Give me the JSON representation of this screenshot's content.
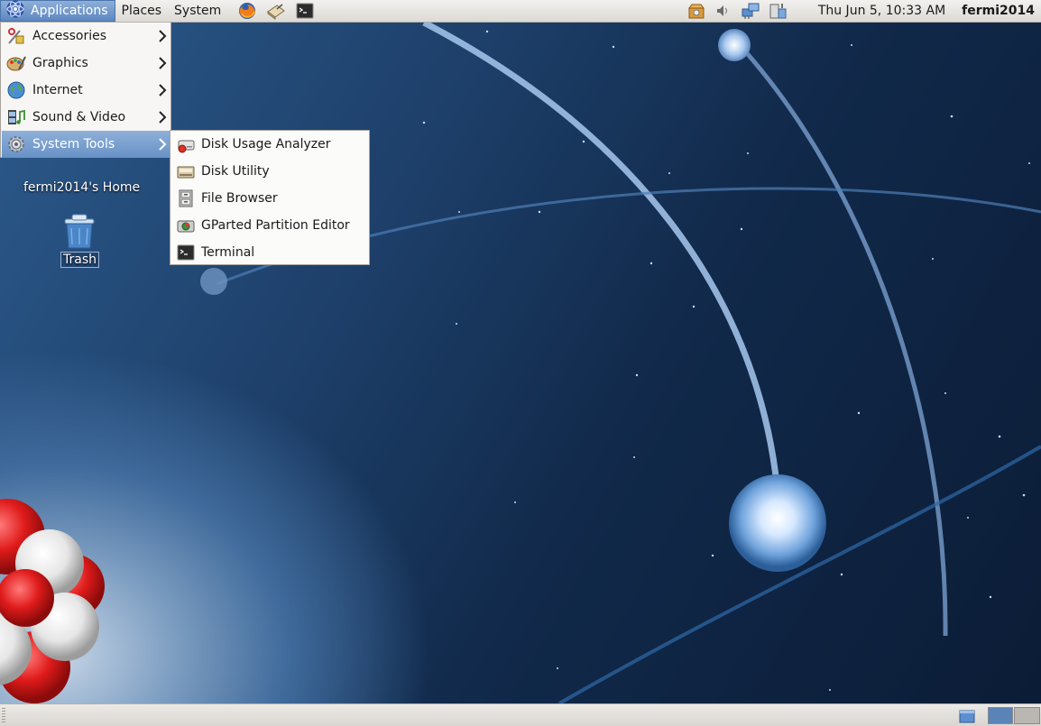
{
  "top_panel": {
    "menus": [
      {
        "label": "Applications"
      },
      {
        "label": "Places"
      },
      {
        "label": "System"
      }
    ],
    "launchers": [
      "firefox-icon",
      "mail-editor-icon",
      "terminal-launcher-icon"
    ],
    "tray": [
      "update-notifier-icon",
      "volume-icon",
      "network-icon",
      "removable-drive-icon"
    ],
    "clock": "Thu Jun  5, 10:33 AM",
    "user": "fermi2014"
  },
  "desktop": {
    "home_label": "fermi2014's Home",
    "trash_label": "Trash"
  },
  "applications_menu": {
    "items": [
      {
        "label": "Accessories",
        "icon": "accessories-icon"
      },
      {
        "label": "Graphics",
        "icon": "graphics-icon"
      },
      {
        "label": "Internet",
        "icon": "internet-icon"
      },
      {
        "label": "Sound & Video",
        "icon": "sound-video-icon"
      },
      {
        "label": "System Tools",
        "icon": "system-tools-icon",
        "highlighted": true
      }
    ]
  },
  "system_tools_submenu": {
    "items": [
      {
        "label": "Disk Usage Analyzer",
        "icon": "disk-usage-analyzer-icon"
      },
      {
        "label": "Disk Utility",
        "icon": "disk-utility-icon"
      },
      {
        "label": "File Browser",
        "icon": "file-cabinet-icon"
      },
      {
        "label": "GParted Partition Editor",
        "icon": "gparted-icon"
      },
      {
        "label": "Terminal",
        "icon": "terminal-icon"
      }
    ]
  },
  "bottom_panel": {
    "active_workspace": 1,
    "workspace_count": 2
  },
  "colors": {
    "highlight": "#6891c6",
    "panel": "#e6e4e0",
    "wallpaper_dark": "#0b1c36"
  }
}
